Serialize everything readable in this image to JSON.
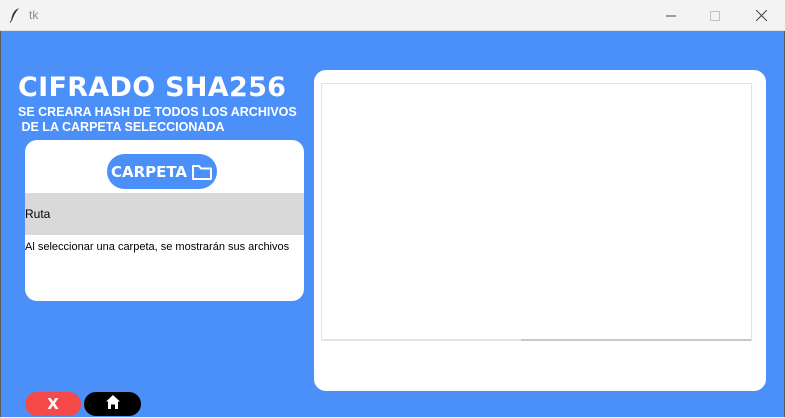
{
  "window": {
    "title": "tk",
    "app_icon": "feather-icon",
    "controls": [
      "minimize-icon",
      "maximize-icon",
      "close-icon"
    ]
  },
  "header": {
    "title": "CIFRADO SHA256",
    "subtitle": "SE CREARA HASH DE TODOS LOS ARCHIVOS\n DE LA CARPETA SELECCIONADA"
  },
  "left_card": {
    "folder_button_label": "CARPETA",
    "folder_button_icon": "folder-icon",
    "route_label": "Ruta",
    "hint": "Al seleccionar una carpeta, se mostrarán sus archivos"
  },
  "right_panel": {
    "file_list_items": []
  },
  "footer": {
    "exit_label": "X",
    "home_icon": "home-icon"
  },
  "colors": {
    "background": "#4b8ff9",
    "card": "#ffffff",
    "accent_button": "#4b8ff9",
    "exit_button": "#f64a4a",
    "home_button": "#000000",
    "route_row": "#d9d9d9"
  }
}
